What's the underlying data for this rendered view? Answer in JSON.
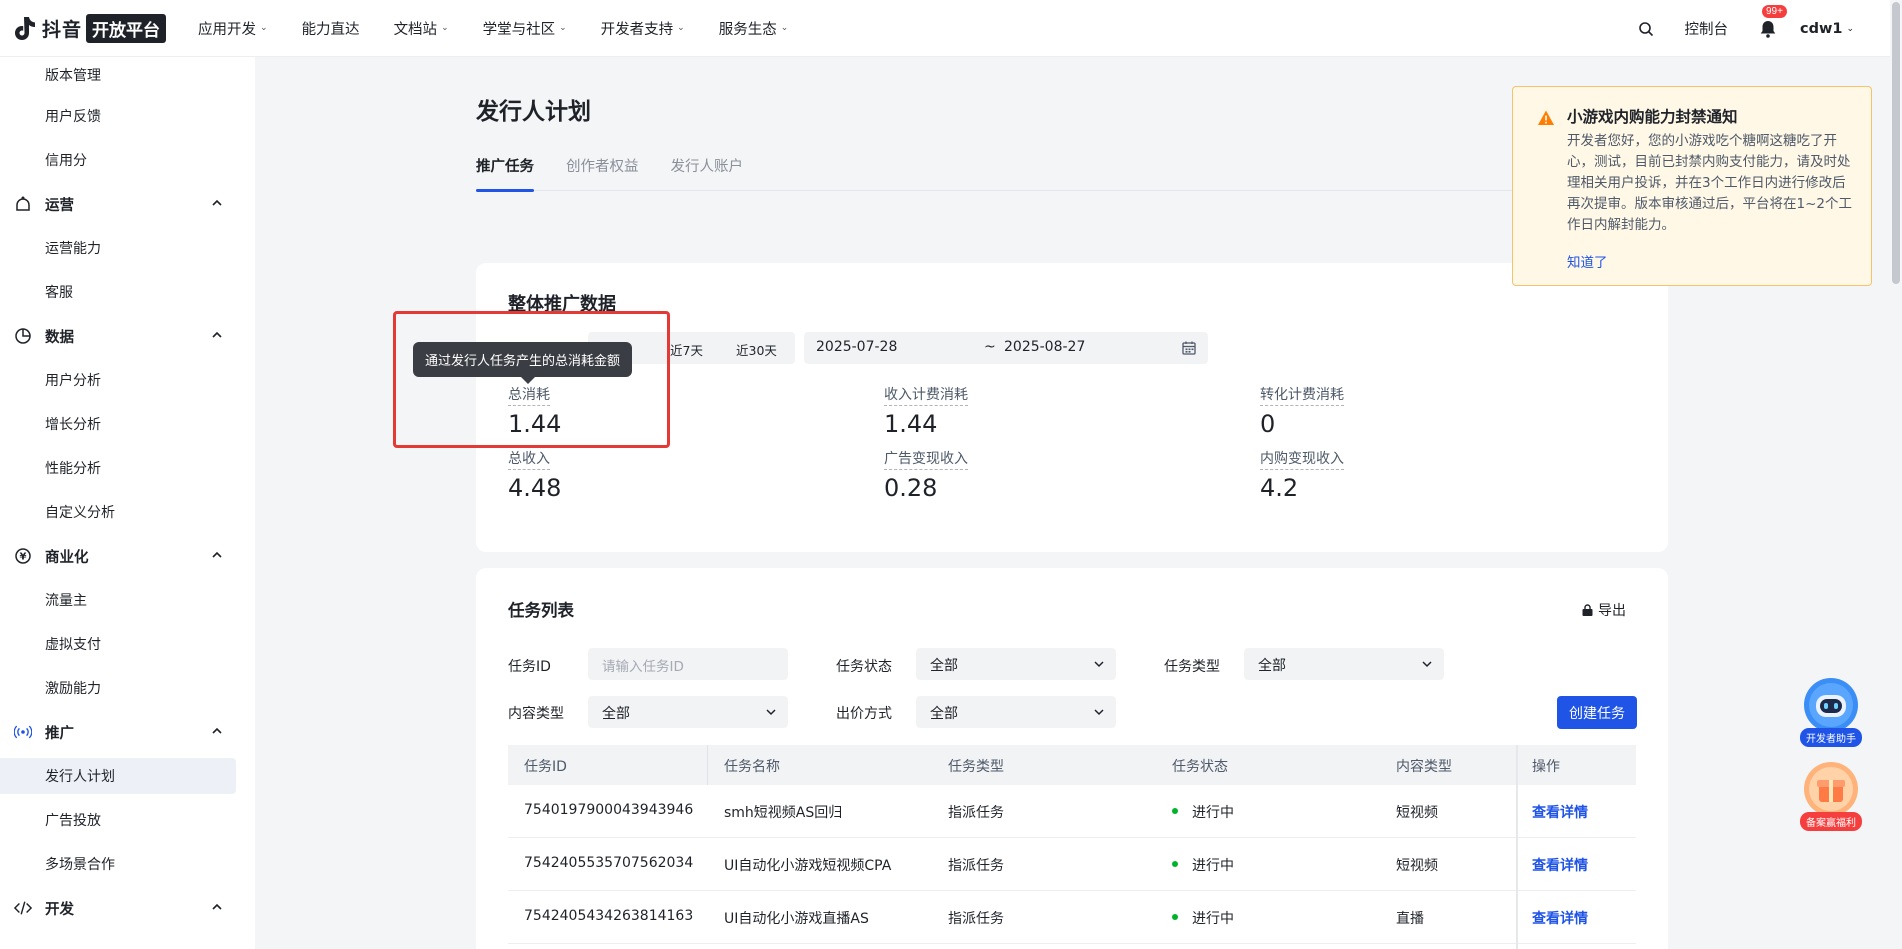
{
  "brand": {
    "logo_text": "抖音",
    "logo_badge": "开放平台"
  },
  "topnav": {
    "items": [
      "应用开发",
      "能力直达",
      "文档站",
      "学堂与社区",
      "开发者支持",
      "服务生态"
    ],
    "console": "控制台",
    "notification_count": "99+",
    "user": "cdw1"
  },
  "sidebar": {
    "items": {
      "version": "版本管理",
      "feedback": "用户反馈",
      "credit": "信用分",
      "ops_group": "运营",
      "ops_ability": "运营能力",
      "support": "客服",
      "data_group": "数据",
      "user_analysis": "用户分析",
      "growth_analysis": "增长分析",
      "perf_analysis": "性能分析",
      "custom_analysis": "自定义分析",
      "biz_group": "商业化",
      "traffic_owner": "流量主",
      "virtual_pay": "虚拟支付",
      "incentive": "激励能力",
      "promo_group": "推广",
      "publisher_plan": "发行人计划",
      "ads": "广告投放",
      "multi_scene": "多场景合作",
      "dev_group": "开发"
    }
  },
  "page": {
    "title": "发行人计划",
    "tabs": [
      "推广任务",
      "创作者权益",
      "发行人账户"
    ]
  },
  "overview": {
    "title": "整体推广数据",
    "ranges": [
      "近7天",
      "近30天"
    ],
    "start_date": "2025-07-28",
    "date_sep": "~",
    "end_date": "2025-08-27",
    "tooltip": "通过发行人任务产生的总消耗金额",
    "metrics": {
      "total_cost_label": "总消耗",
      "total_cost": "1.44",
      "income_cost_label": "收入计费消耗",
      "income_cost": "1.44",
      "conv_cost_label": "转化计费消耗",
      "conv_cost": "0",
      "total_income_label": "总收入",
      "total_income": "4.48",
      "ad_income_label": "广告变现收入",
      "ad_income": "0.28",
      "iap_income_label": "内购变现收入",
      "iap_income": "4.2"
    }
  },
  "notice": {
    "title": "小游戏内购能力封禁通知",
    "body": "开发者您好，您的小游戏吃个糖啊这糖吃了开心，测试，目前已封禁内购支付能力，请及时处理相关用户投诉，并在3个工作日内进行修改后再次提审。版本审核通过后，平台将在1~2个工作日内解封能力。",
    "link": "知道了"
  },
  "tasks": {
    "title": "任务列表",
    "export": "导出",
    "filters": {
      "task_id_label": "任务ID",
      "task_id_placeholder": "请输入任务ID",
      "status_label": "任务状态",
      "status_value": "全部",
      "type_label": "任务类型",
      "type_value": "全部",
      "content_label": "内容类型",
      "content_value": "全部",
      "bid_label": "出价方式",
      "bid_value": "全部"
    },
    "create_button": "创建任务",
    "columns": [
      "任务ID",
      "任务名称",
      "任务类型",
      "任务状态",
      "内容类型",
      "操作"
    ],
    "rows": [
      {
        "id": "7540197900043943946",
        "name": "smh短视频AS回归",
        "type": "指派任务",
        "status": "进行中",
        "content": "短视频",
        "action": "查看详情"
      },
      {
        "id": "7542405535707562034",
        "name": "UI自动化小游戏短视频CPA",
        "type": "指派任务",
        "status": "进行中",
        "content": "短视频",
        "action": "查看详情"
      },
      {
        "id": "7542405434263814163",
        "name": "UI自动化小游戏直播AS",
        "type": "指派任务",
        "status": "进行中",
        "content": "直播",
        "action": "查看详情"
      }
    ]
  },
  "floating": {
    "assistant": "开发者助手",
    "benefit": "备案赢福利"
  },
  "colors": {
    "accent": "#1f54e6",
    "highlight": "#e53935",
    "success": "#00b42a",
    "warning": "#ff7d00"
  }
}
